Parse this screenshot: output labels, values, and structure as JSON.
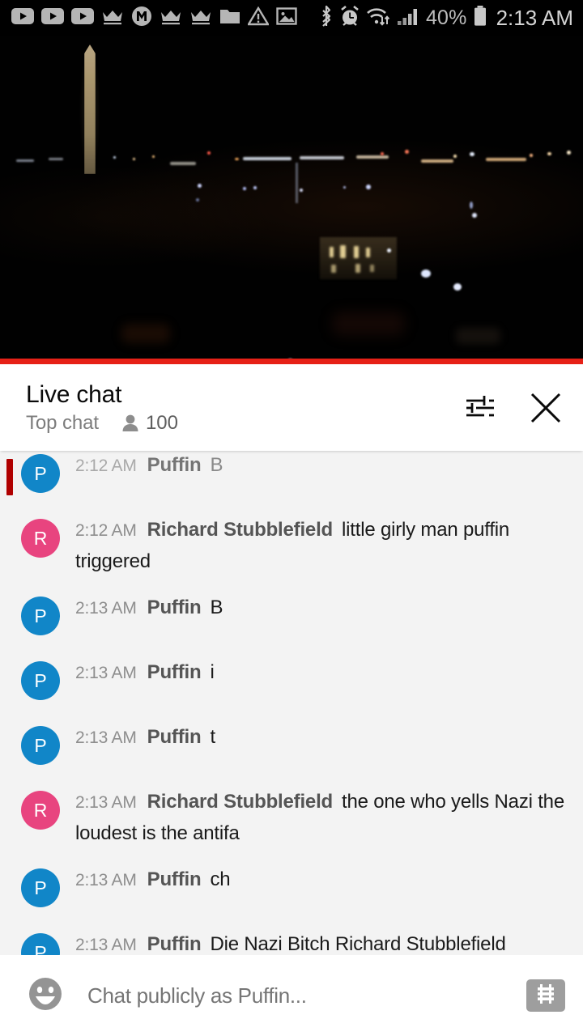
{
  "statusbar": {
    "left_icons": [
      {
        "name": "youtube-play-icon-1",
        "glyph": "youtube"
      },
      {
        "name": "youtube-play-icon-2",
        "glyph": "youtube"
      },
      {
        "name": "youtube-play-icon-3",
        "glyph": "youtube"
      },
      {
        "name": "crown-icon-1",
        "glyph": "crown"
      },
      {
        "name": "m-circle-icon",
        "glyph": "m-circle"
      },
      {
        "name": "crown-icon-2",
        "glyph": "crown"
      },
      {
        "name": "crown-icon-3",
        "glyph": "crown"
      },
      {
        "name": "folder-icon",
        "glyph": "folder"
      },
      {
        "name": "warning-triangle-icon",
        "glyph": "warning"
      },
      {
        "name": "image-icon",
        "glyph": "image"
      }
    ],
    "right_icons": [
      {
        "name": "bluetooth-icon",
        "glyph": "bluetooth"
      },
      {
        "name": "alarm-clock-icon",
        "glyph": "alarm"
      },
      {
        "name": "wifi-icon",
        "glyph": "wifi"
      },
      {
        "name": "cellular-signal-icon",
        "glyph": "signal"
      }
    ],
    "battery_percent": "40%",
    "time": "2:13 AM"
  },
  "video": {
    "progress_color": "#e62117",
    "scene": "Washington DC night skyline with Washington Monument and White House"
  },
  "chat_header": {
    "title": "Live chat",
    "subtitle": "Top chat",
    "viewer_count": "100",
    "settings_icon": "tune-sliders-icon",
    "close_icon": "close-icon"
  },
  "messages": [
    {
      "avatar_letter": "P",
      "avatar_color": "#1186c8",
      "time": "2:12 AM",
      "author": "Puffin",
      "text": "B",
      "faded": true,
      "lines": 1
    },
    {
      "avatar_letter": "R",
      "avatar_color": "#e8447f",
      "time": "2:12 AM",
      "author": "Richard Stubblefield",
      "text": "little girly man puffin triggered",
      "faded": false,
      "lines": 2
    },
    {
      "avatar_letter": "P",
      "avatar_color": "#1186c8",
      "time": "2:13 AM",
      "author": "Puffin",
      "text": "B",
      "faded": false,
      "lines": 1
    },
    {
      "avatar_letter": "P",
      "avatar_color": "#1186c8",
      "time": "2:13 AM",
      "author": "Puffin",
      "text": "i",
      "faded": false,
      "lines": 1
    },
    {
      "avatar_letter": "P",
      "avatar_color": "#1186c8",
      "time": "2:13 AM",
      "author": "Puffin",
      "text": "t",
      "faded": false,
      "lines": 1
    },
    {
      "avatar_letter": "R",
      "avatar_color": "#e8447f",
      "time": "2:13 AM",
      "author": "Richard Stubblefield",
      "text": "the one who yells Nazi the loudest is the antifa",
      "faded": false,
      "lines": 2
    },
    {
      "avatar_letter": "P",
      "avatar_color": "#1186c8",
      "time": "2:13 AM",
      "author": "Puffin",
      "text": "ch",
      "faded": false,
      "lines": 1
    },
    {
      "avatar_letter": "P",
      "avatar_color": "#1186c8",
      "time": "2:13 AM",
      "author": "Puffin",
      "text": "Die Nazi Bitch Richard Stubblefield",
      "faded": false,
      "lines": 1
    }
  ],
  "chat_input": {
    "placeholder": "Chat publicly as Puffin...",
    "value": "",
    "emoji_icon": "emoji-smiley-icon",
    "superchat_icon": "dollar-superchat-icon"
  }
}
